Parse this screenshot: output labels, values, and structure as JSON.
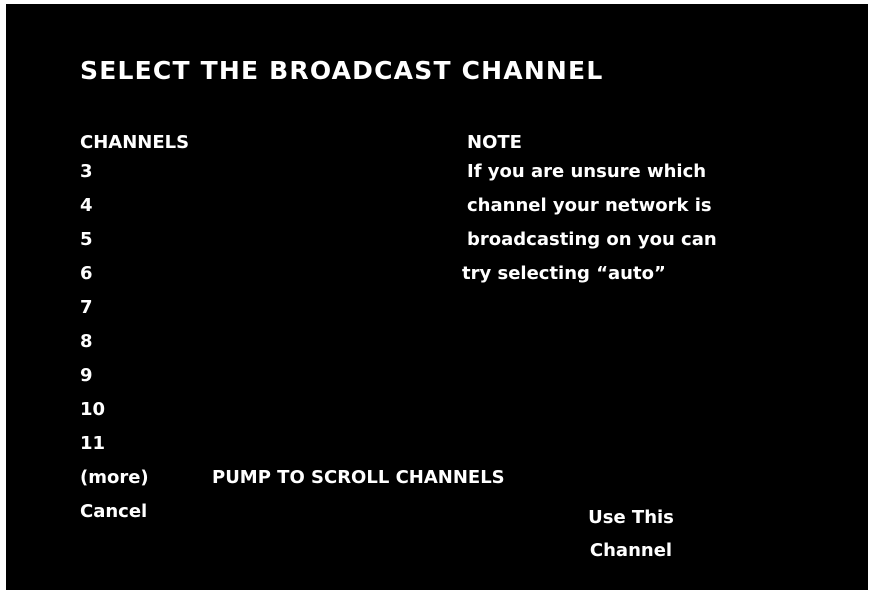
{
  "title": "SELECT THE BROADCAST CHANNEL",
  "channels": {
    "header": "CHANNELS",
    "items": [
      "3",
      "4",
      "5",
      "6",
      "7",
      "8",
      "9",
      "10",
      "11"
    ],
    "more_label": "(more)",
    "scroll_hint": "PUMP TO SCROLL CHANNELS"
  },
  "note": {
    "header": "NOTE",
    "lines": [
      "If you are unsure which",
      "channel your network is",
      "broadcasting on you can",
      "try selecting “auto”"
    ]
  },
  "actions": {
    "cancel_label": "Cancel",
    "use_channel_label": "Use This Channel"
  },
  "colors": {
    "background": "#000000",
    "text": "#ffffff"
  }
}
